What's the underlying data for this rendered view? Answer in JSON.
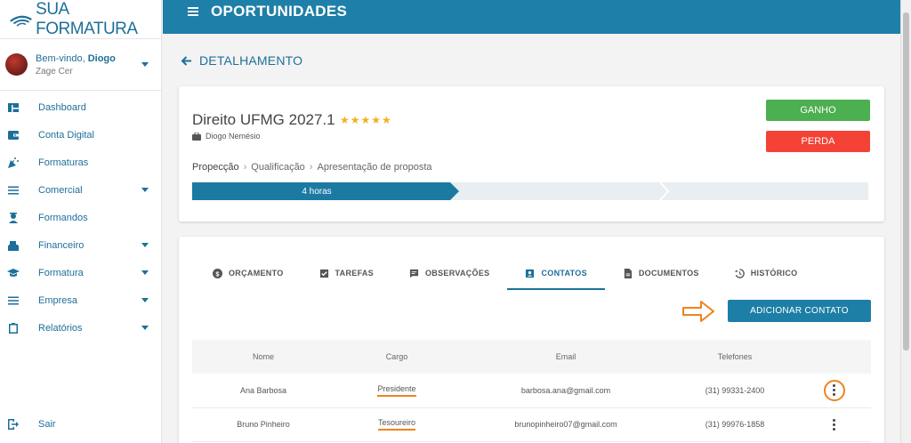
{
  "brand": {
    "name": "SUA FORMATURA"
  },
  "user": {
    "greeting": "Bem-vindo,",
    "name": "Diogo",
    "company": "Zage Cer"
  },
  "sidebar": {
    "items": [
      {
        "label": "Dashboard",
        "icon": "dashboard-icon"
      },
      {
        "label": "Conta Digital",
        "icon": "wallet-icon"
      },
      {
        "label": "Formaturas",
        "icon": "party-icon"
      },
      {
        "label": "Comercial",
        "icon": "menu-icon"
      },
      {
        "label": "Formandos",
        "icon": "graduate-icon"
      },
      {
        "label": "Financeiro",
        "icon": "cash-register-icon"
      },
      {
        "label": "Formatura",
        "icon": "graduation-cap-icon"
      },
      {
        "label": "Empresa",
        "icon": "menu-icon"
      },
      {
        "label": "Relatórios",
        "icon": "clipboard-icon"
      }
    ],
    "logout": "Sair"
  },
  "header": {
    "title": "OPORTUNIDADES"
  },
  "page": {
    "back_label": "DETALHAMENTO"
  },
  "deal": {
    "title": "Direito UFMG 2027.1",
    "stars": "★★★★★",
    "owner": "Diogo Nemésio",
    "win_label": "GANHO",
    "lose_label": "PERDA",
    "steps": [
      "Propecção",
      "Qualificação",
      "Apresentação de proposta"
    ],
    "pipeline_time": "4 horas"
  },
  "tabs": [
    {
      "label": "ORÇAMENTO"
    },
    {
      "label": "TAREFAS"
    },
    {
      "label": "OBSERVAÇÕES"
    },
    {
      "label": "CONTATOS"
    },
    {
      "label": "DOCUMENTOS"
    },
    {
      "label": "HISTÓRICO"
    }
  ],
  "contacts": {
    "add_label": "ADICIONAR CONTATO",
    "columns": [
      "Nome",
      "Cargo",
      "Email",
      "Telefones"
    ],
    "rows": [
      {
        "name": "Ana Barbosa",
        "role": "Presidente",
        "email": "barbosa.ana@gmail.com",
        "phone": "(31) 99331-2400"
      },
      {
        "name": "Bruno Pinheiro",
        "role": "Tesoureiro",
        "email": "brunopinheiro07@gmail.com",
        "phone": "(31) 99976-1858"
      }
    ]
  },
  "colors": {
    "primary": "#1e7fa8",
    "success": "#4caf50",
    "danger": "#f44336",
    "annotation": "#f0821f",
    "star": "#f2b01e"
  }
}
